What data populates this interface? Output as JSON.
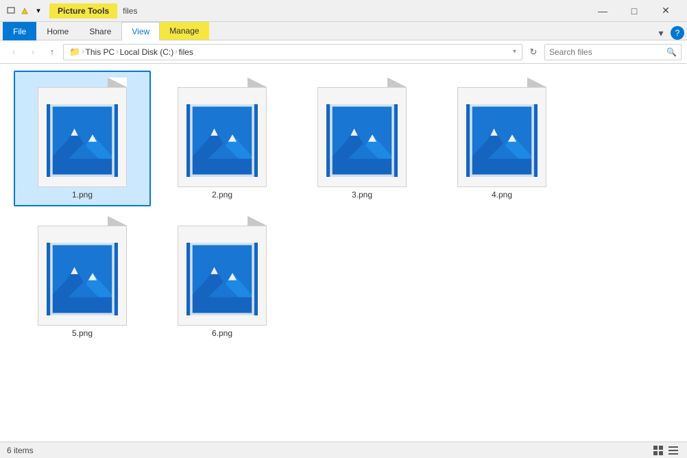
{
  "titleBar": {
    "appName": "files",
    "pictureToolsLabel": "Picture Tools",
    "windowControls": {
      "minimize": "—",
      "maximize": "□",
      "close": "✕"
    }
  },
  "ribbon": {
    "tabs": [
      {
        "id": "file",
        "label": "File",
        "type": "file"
      },
      {
        "id": "home",
        "label": "Home",
        "type": "normal"
      },
      {
        "id": "share",
        "label": "Share",
        "type": "normal"
      },
      {
        "id": "view",
        "label": "View",
        "type": "normal",
        "active": true
      },
      {
        "id": "manage",
        "label": "Manage",
        "type": "manage"
      }
    ]
  },
  "addressBar": {
    "backBtn": "‹",
    "forwardBtn": "›",
    "upBtn": "↑",
    "refreshBtn": "↻",
    "pathSegments": [
      {
        "label": "This PC"
      },
      {
        "label": "Local Disk (C:)"
      },
      {
        "label": "files",
        "current": true
      }
    ],
    "search": {
      "placeholder": "Search files",
      "value": ""
    }
  },
  "files": [
    {
      "id": 1,
      "name": "1.png",
      "selected": true
    },
    {
      "id": 2,
      "name": "2.png",
      "selected": false
    },
    {
      "id": 3,
      "name": "3.png",
      "selected": false
    },
    {
      "id": 4,
      "name": "4.png",
      "selected": false
    },
    {
      "id": 5,
      "name": "5.png",
      "selected": false
    },
    {
      "id": 6,
      "name": "6.png",
      "selected": false
    }
  ],
  "statusBar": {
    "itemCount": "6 items"
  },
  "colors": {
    "accent": "#0078d4",
    "pictureToolsTab": "#f5e642",
    "imageBlue": "#1565c0",
    "imageLightBlue": "#1e88e5"
  }
}
